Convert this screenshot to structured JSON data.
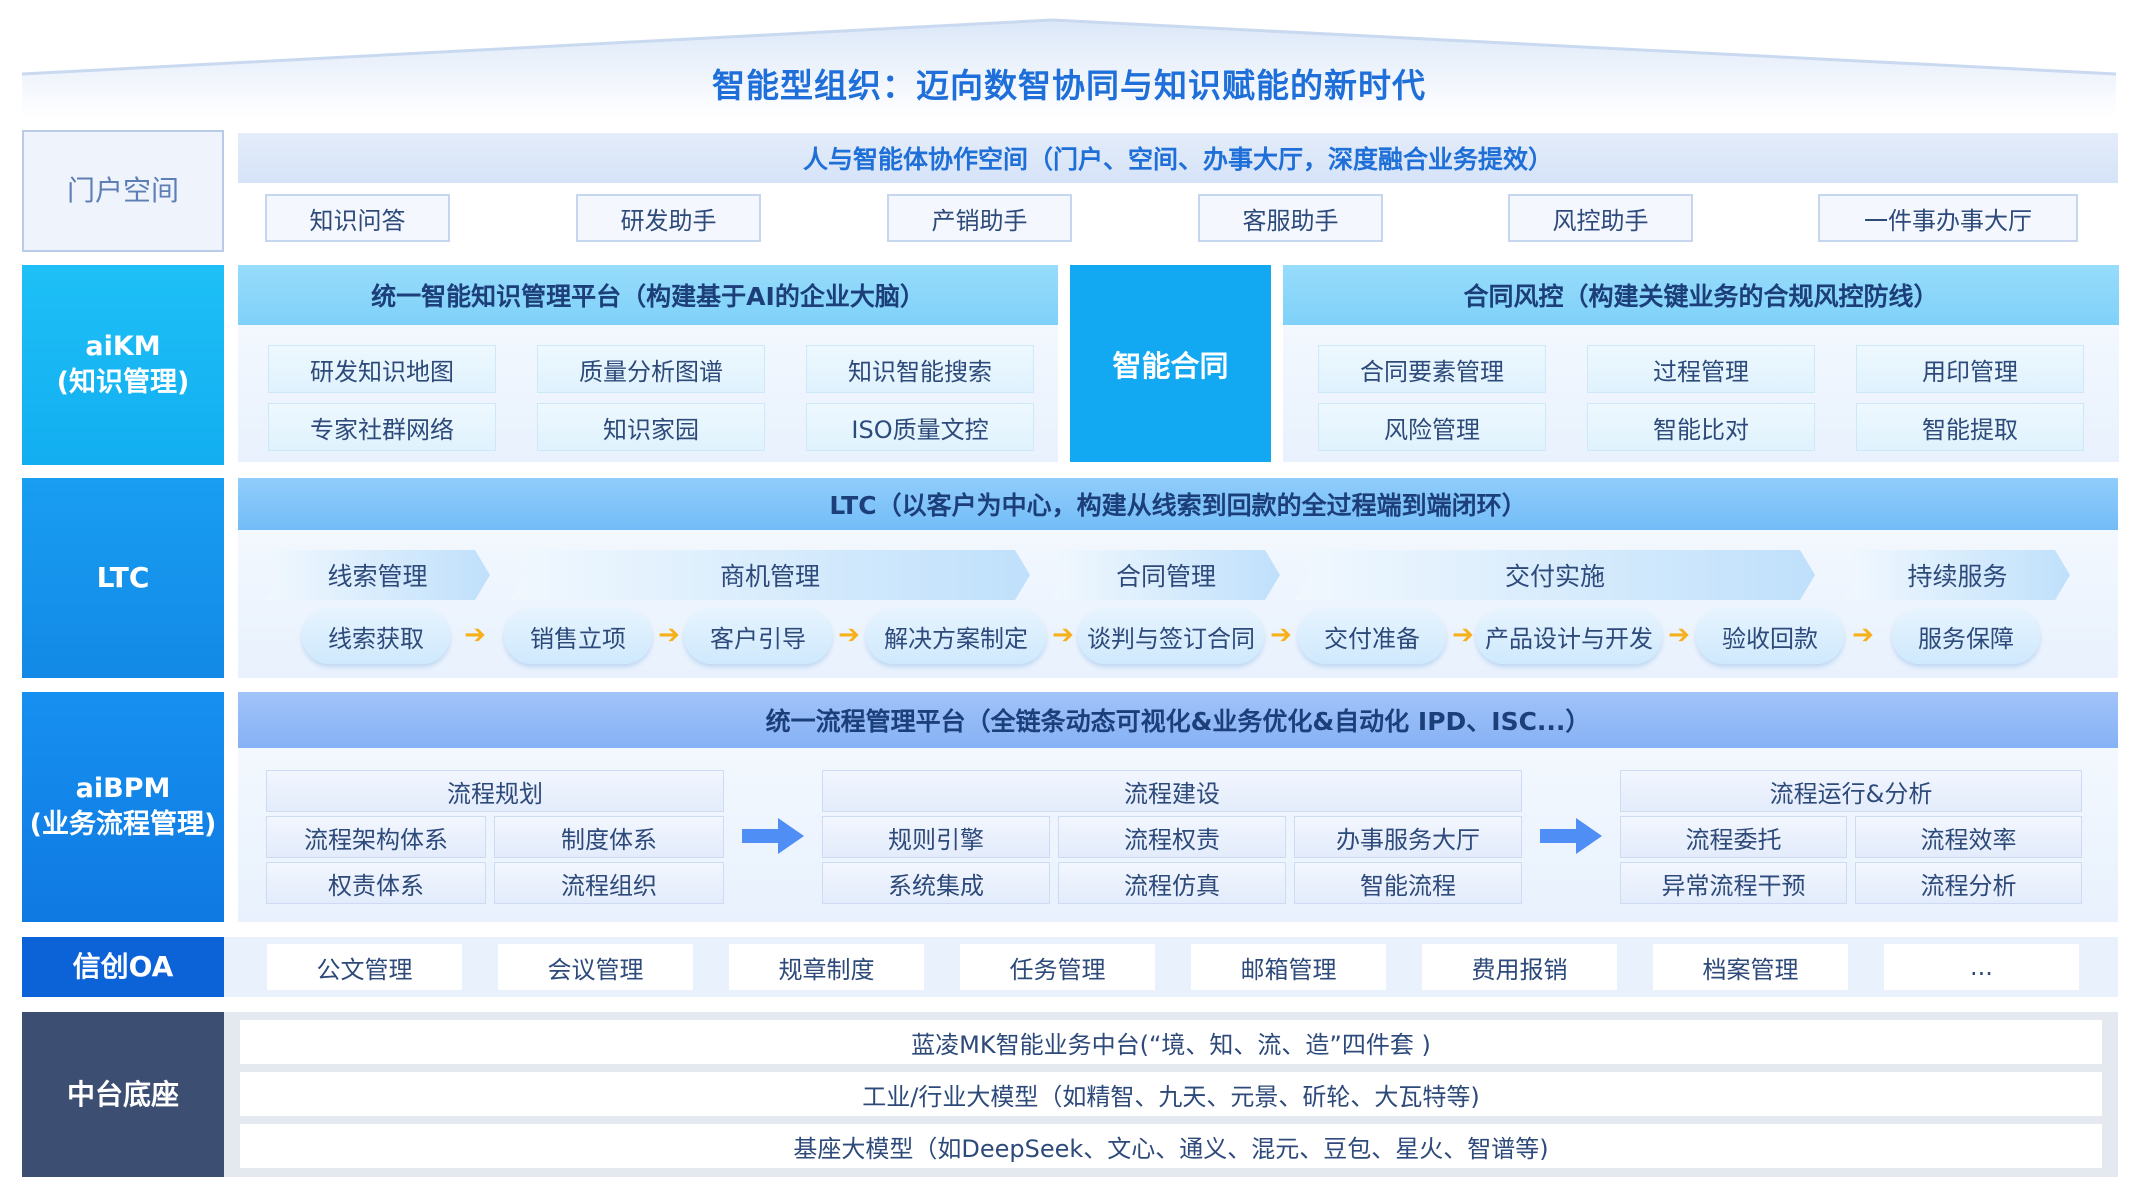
{
  "title": "智能型组织：迈向数智协同与知识赋能的新时代",
  "rows": {
    "portal": {
      "label": "门户空间",
      "header": "人与智能体协作空间（门户、空间、办事大厅，深度融合业务提效）",
      "items": [
        "知识问答",
        "研发助手",
        "产销助手",
        "客服助手",
        "风控助手",
        "一件事办事大厅"
      ]
    },
    "aikm": {
      "label": "aiKM",
      "label_sub": "(知识管理)",
      "km_header": "统一智能知识管理平台（构建基于AI的企业大脑）",
      "km_items": [
        "研发知识地图",
        "质量分析图谱",
        "知识智能搜索",
        "专家社群网络",
        "知识家园",
        "ISO质量文控"
      ],
      "center": "智能合同",
      "contract_header": "合同风控（构建关键业务的合规风控防线）",
      "contract_items": [
        "合同要素管理",
        "过程管理",
        "用印管理",
        "风险管理",
        "智能比对",
        "智能提取"
      ]
    },
    "ltc": {
      "label": "LTC",
      "header": "LTC（以客户为中心，构建从线索到回款的全过程端到端闭环）",
      "stages": [
        "线索管理",
        "商机管理",
        "合同管理",
        "交付实施",
        "持续服务"
      ],
      "steps": [
        "线索获取",
        "销售立项",
        "客户引导",
        "解决方案制定",
        "谈判与签订合同",
        "交付准备",
        "产品设计与开发",
        "验收回款",
        "服务保障"
      ]
    },
    "aibpm": {
      "label": "aiBPM",
      "label_sub": "(业务流程管理)",
      "header": "统一流程管理平台（全链条动态可视化&业务优化&自动化 IPD、ISC...）",
      "groups": [
        {
          "title": "流程规划",
          "items": [
            "流程架构体系",
            "制度体系",
            "权责体系",
            "流程组织"
          ]
        },
        {
          "title": "流程建设",
          "items": [
            "规则引擎",
            "流程权责",
            "办事服务大厅",
            "系统集成",
            "流程仿真",
            "智能流程"
          ]
        },
        {
          "title": "流程运行&分析",
          "items": [
            "流程委托",
            "流程效率",
            "异常流程干预",
            "流程分析"
          ]
        }
      ]
    },
    "oa": {
      "label": "信创OA",
      "items": [
        "公文管理",
        "会议管理",
        "规章制度",
        "任务管理",
        "邮箱管理",
        "费用报销",
        "档案管理",
        "..."
      ]
    },
    "base": {
      "label": "中台底座",
      "lines": [
        "蓝凌MK智能业务中台(“境、知、流、造”四件套 )",
        "工业/行业大模型（如精智、九天、元景、斫轮、大瓦特等)",
        "基座大模型（如DeepSeek、文心、通义、混元、豆包、星火、智谱等)"
      ]
    }
  },
  "colors": {
    "title": "#1e6fd9",
    "oa": "#0c63d8",
    "base": "#3d4e73",
    "arrow_yellow": "#f6b11a",
    "arrow_blue": "#4f8ef5"
  }
}
